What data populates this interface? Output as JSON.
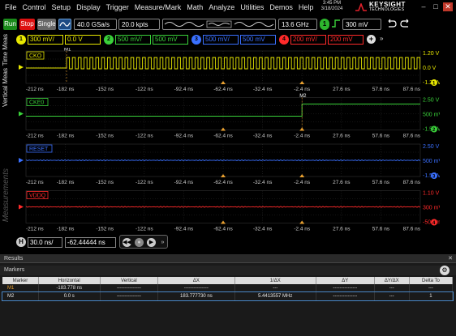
{
  "menu": [
    "File",
    "Control",
    "Setup",
    "Display",
    "Trigger",
    "Measure/Mark",
    "Math",
    "Analyze",
    "Utilities",
    "Demos",
    "Help"
  ],
  "clock": {
    "time": "3:45 PM",
    "date": "3/18/2024"
  },
  "brand": {
    "name": "KEYSIGHT",
    "sub": "TECHNOLOGIES"
  },
  "toolbar": {
    "run": "Run",
    "stop": "Stop",
    "single": "Single",
    "sample_rate": "40.0 GSa/s",
    "points": "20.0 kpts",
    "bandwidth": "13.6 GHz",
    "trigger_channel": "1",
    "trigger_level": "300 mV"
  },
  "channels": [
    {
      "num": "1",
      "scale": "300 mV/",
      "offset": "0.0 V",
      "color": "#e8e800"
    },
    {
      "num": "2",
      "scale": "500 mV/",
      "offset": "500 mV",
      "color": "#3ad13a"
    },
    {
      "num": "3",
      "scale": "500 mV/",
      "offset": "500 mV",
      "color": "#3a70ff"
    },
    {
      "num": "4",
      "scale": "200 mV/",
      "offset": "200 mV",
      "color": "#ff2a2a"
    }
  ],
  "tabs": {
    "meas": "Time Meas",
    "vert": "Vertical Meas",
    "measurements": "Measurements"
  },
  "panels": [
    {
      "label": "CKO",
      "color": "#e8e800",
      "scale_top": "1.20 V",
      "scale_mid": "0.0 V",
      "scale_bot": "-1.20 V",
      "badge": "1",
      "wave": "clock"
    },
    {
      "label": "CKE0",
      "color": "#3ad13a",
      "scale_top": "2.50 V",
      "scale_mid": "500 mV",
      "scale_bot": "-1.50 V",
      "badge": "2",
      "wave": "step"
    },
    {
      "label": "RESET",
      "color": "#3a70ff",
      "scale_top": "2.50 V",
      "scale_mid": "500 mV",
      "scale_bot": "-1.50 V",
      "badge": "3",
      "wave": "flat"
    },
    {
      "label": "VDDQ",
      "color": "#ff2a2a",
      "scale_top": "1.10 V",
      "scale_mid": "300 mV",
      "scale_bot": "-500 mV",
      "badge": "4",
      "wave": "flat"
    }
  ],
  "time_ticks": [
    "-212 ns",
    "-182 ns",
    "-152 ns",
    "-122 ns",
    "-92.4 ns",
    "-62.4 ns",
    "-32.4 ns",
    "-2.4 ns",
    "27.6 ns",
    "57.6 ns",
    "87.6 ns"
  ],
  "markers": {
    "m1": "M1",
    "m2": "M2"
  },
  "timebase": {
    "badge": "H",
    "scale": "30.0 ns/",
    "position": "-62.44444 ns"
  },
  "results": {
    "title": "Results",
    "section": "Markers",
    "columns": [
      "Marker",
      "Horizontal",
      "Vertical",
      "ΔX",
      "1/ΔX",
      "ΔY",
      "ΔY/ΔX",
      "Delta To"
    ],
    "rows": [
      [
        "M1",
        "-183.778 ns",
        "---------------",
        "---------------",
        "---",
        "---------------",
        "---",
        "---"
      ],
      [
        "M2",
        "0.0 s",
        "---------------",
        "183.777730 ns",
        "5.4413557 MHz",
        "---------------",
        "---",
        "1"
      ]
    ]
  }
}
